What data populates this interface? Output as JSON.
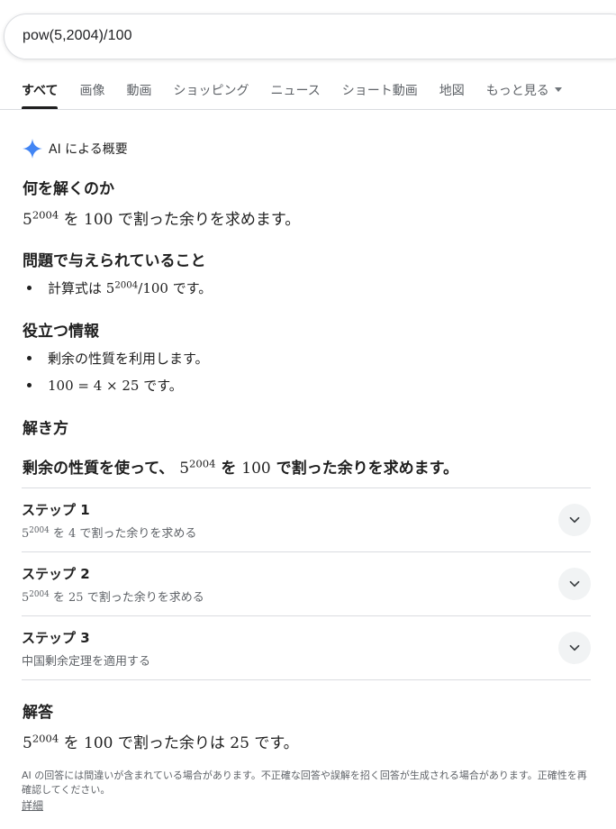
{
  "search": {
    "query": "pow(5,2004)/100"
  },
  "tabs": [
    {
      "label": "すべて"
    },
    {
      "label": "画像"
    },
    {
      "label": "動画"
    },
    {
      "label": "ショッピング"
    },
    {
      "label": "ニュース"
    },
    {
      "label": "ショート動画"
    },
    {
      "label": "地図"
    },
    {
      "label": "もっと見る"
    }
  ],
  "ai_overview": {
    "label": "AI による概要",
    "sections": {
      "what": {
        "heading": "何を解くのか",
        "base": "5",
        "exp": "2004",
        "mid": " を ",
        "num": "100",
        "tail": " で割った余りを求めます。"
      },
      "given": {
        "heading": "問題で与えられていること",
        "pre": "計算式は ",
        "base": "5",
        "exp": "2004",
        "expr": "/100",
        "tail": " です。"
      },
      "info": {
        "heading": "役立つ情報",
        "item1": "剰余の性質を利用します。",
        "item2_math": "100 = 4 × 25",
        "item2_tail": " です。"
      },
      "howto": {
        "heading": "解き方",
        "intro_pre": "剰余の性質を使って、 ",
        "base": "5",
        "exp": "2004",
        "mid": " を ",
        "num": "100",
        "tail": " で割った余りを求めます。"
      },
      "steps": [
        {
          "title": "ステップ 1",
          "base": "5",
          "exp": "2004",
          "mid": " を ",
          "num": "4",
          "tail": " で割った余りを求める"
        },
        {
          "title": "ステップ 2",
          "base": "5",
          "exp": "2004",
          "mid": " を ",
          "num": "25",
          "tail": " で割った余りを求める"
        },
        {
          "title": "ステップ 3",
          "sub": "中国剰余定理を適用する"
        }
      ],
      "answer": {
        "heading": "解答",
        "base": "5",
        "exp": "2004",
        "mid": " を ",
        "num": "100",
        "mid2": " で割った余りは ",
        "res": "25",
        "tail": " です。"
      }
    },
    "disclaimer": "AI の回答には間違いが含まれている場合があります。不正確な回答や誤解を招く回答が生成される場合があります。正確性を再確認してください。",
    "details_link": "詳細"
  },
  "colors": {
    "accent_star": "#4285f4",
    "text": "#1f1f1f",
    "muted": "#5f6368"
  },
  "icons": {
    "ai": "sparkle-icon",
    "expand": "chevron-down-icon",
    "more": "caret-down-icon"
  }
}
